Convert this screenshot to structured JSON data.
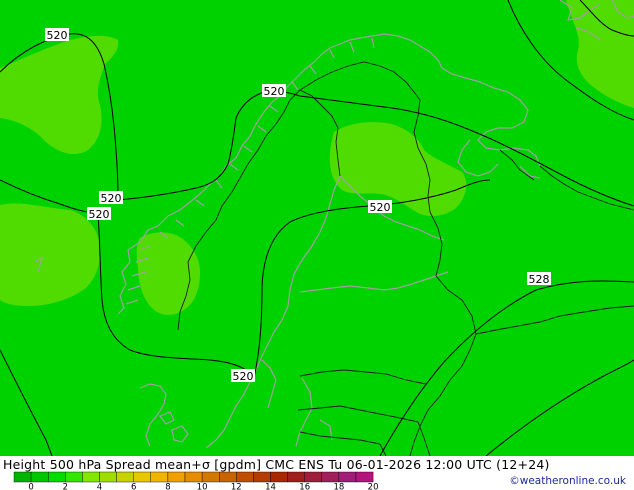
{
  "footer": {
    "title": "Height 500 hPa Spread mean+σ [gpdm] CMC ENS Tu 06-01-2026 12:00 UTC (12+24)",
    "credit": "©weatheronline.co.uk"
  },
  "legend": {
    "ticks": [
      "0",
      "2",
      "4",
      "6",
      "8",
      "10",
      "12",
      "14",
      "16",
      "18",
      "20"
    ],
    "colors": [
      "#00b400",
      "#00c800",
      "#00dc00",
      "#32e600",
      "#82e600",
      "#a0dc00",
      "#c8d200",
      "#e6c800",
      "#f0b400",
      "#f0a000",
      "#e68c00",
      "#d27800",
      "#c86400",
      "#be5000",
      "#b43c00",
      "#aa2800",
      "#a01e1e",
      "#a01e3c",
      "#a01e5a",
      "#a01e78",
      "#b4147c"
    ]
  },
  "map": {
    "base_color": "#00d200",
    "light_color": "#50dc00",
    "coast_color": "#a0a0a0",
    "border_color": "#1e1e1e",
    "contour_color": "#000000",
    "contour_labels": [
      "520",
      "520",
      "520",
      "520",
      "520",
      "520",
      "528"
    ]
  }
}
